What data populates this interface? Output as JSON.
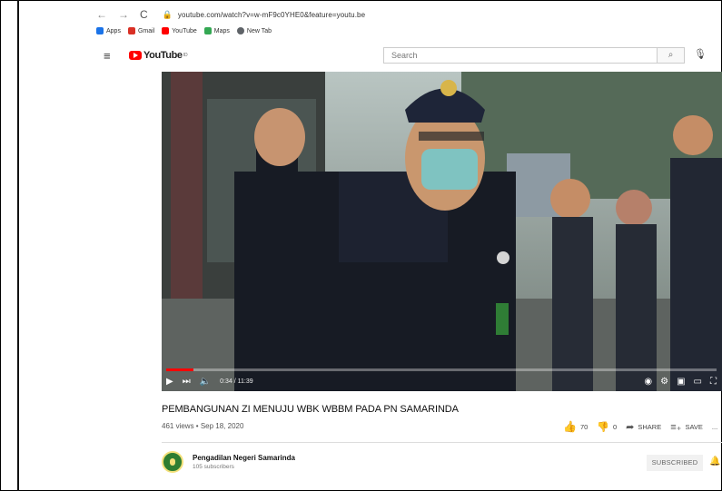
{
  "browser": {
    "url": "youtube.com/watch?v=w-mF9c0YHE0&feature=youtu.be",
    "bookmarks": [
      {
        "label": "Apps",
        "color": "#1a73e8"
      },
      {
        "label": "Gmail",
        "color": "#d93025"
      },
      {
        "label": "YouTube",
        "color": "#ff0000"
      },
      {
        "label": "Maps",
        "color": "#34a853"
      },
      {
        "label": "New Tab",
        "color": "#5f6368"
      }
    ]
  },
  "youtube": {
    "logo_text": "YouTube",
    "logo_suffix": "ID",
    "search_placeholder": "Search"
  },
  "player": {
    "time": "0:34 / 11:39",
    "progress_fraction": 0.049
  },
  "video": {
    "title": "PEMBANGUNAN ZI MENUJU WBK WBBM PADA PN SAMARINDA",
    "meta": "461 views • Sep 18, 2020",
    "likes": "70",
    "dislikes": "0",
    "share_label": "SHARE",
    "save_label": "SAVE",
    "more_label": "..."
  },
  "channel": {
    "name": "Pengadilan Negeri Samarinda",
    "subscribers": "105 subscribers",
    "subscribe_state": "SUBSCRIBED"
  },
  "colors": {
    "accent": "#ff0000",
    "like_active": "#1565c0"
  }
}
